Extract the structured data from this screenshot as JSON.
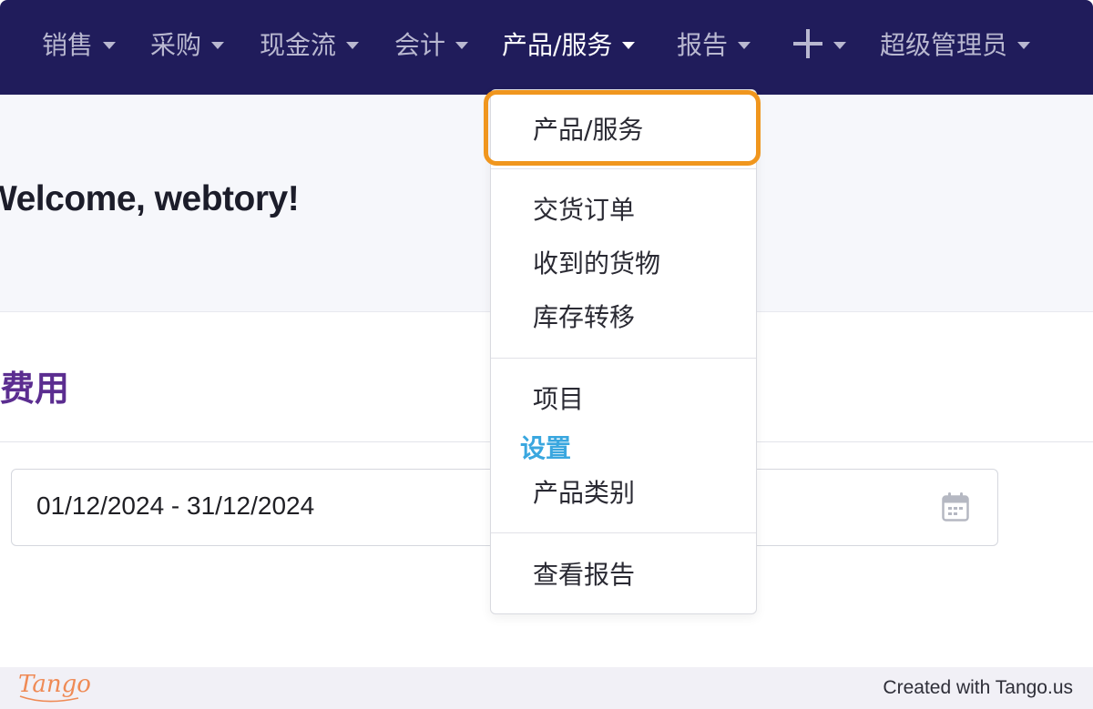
{
  "nav": {
    "items": [
      {
        "label": "销售"
      },
      {
        "label": "采购"
      },
      {
        "label": "现金流"
      },
      {
        "label": "会计"
      },
      {
        "label": "产品/服务",
        "active": true
      },
      {
        "label": "报告"
      },
      {
        "label": "超级管理员"
      }
    ],
    "plus_icon": "plus-icon"
  },
  "welcome": {
    "title": "Welcome, webtory!"
  },
  "expenses": {
    "title": "费用",
    "date_range": "01/12/2024 - 31/12/2024",
    "calendar_icon": "calendar-icon"
  },
  "dropdown": {
    "items": [
      "产品/服务",
      "交货订单",
      "收到的货物",
      "库存转移",
      "项目",
      "产品类别",
      "查看报告"
    ],
    "section_header": "设置",
    "highlight_color": "#f0961e"
  },
  "footer": {
    "logo": "Tango",
    "credit": "Created with Tango.us"
  },
  "colors": {
    "navbar": "#201c5b",
    "section_title": "#5b2d90",
    "settings_header": "#3aa7df"
  }
}
